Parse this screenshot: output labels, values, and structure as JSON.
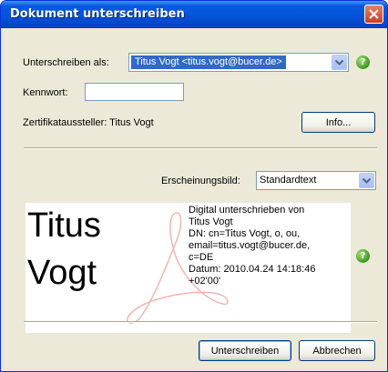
{
  "window": {
    "title": "Dokument unterschreiben"
  },
  "sign_as": {
    "label": "Unterschreiben als:",
    "value": "Titus Vogt <titus.vogt@bucer.de>"
  },
  "password": {
    "label": "Kennwort:",
    "value": ""
  },
  "issuer": {
    "label": "Zertifikataussteller: Titus Vogt"
  },
  "info_button": {
    "label": "Info..."
  },
  "appearance": {
    "label": "Erscheinungsbild:",
    "value": "Standardtext"
  },
  "preview": {
    "name_line1": "Titus",
    "name_line2": "Vogt",
    "details": [
      "Digital unterschrieben von",
      "Titus Vogt",
      "DN: cn=Titus Vogt, o, ou,",
      "email=titus.vogt@bucer.de,",
      "c=DE",
      "Datum: 2010.04.24 14:18:46",
      "+02'00'"
    ]
  },
  "buttons": {
    "sign": "Unterschreiben",
    "cancel": "Abbrechen"
  },
  "icons": {
    "help": "?",
    "help_color": "#3b9a1c",
    "close_color": "#c9401f"
  }
}
